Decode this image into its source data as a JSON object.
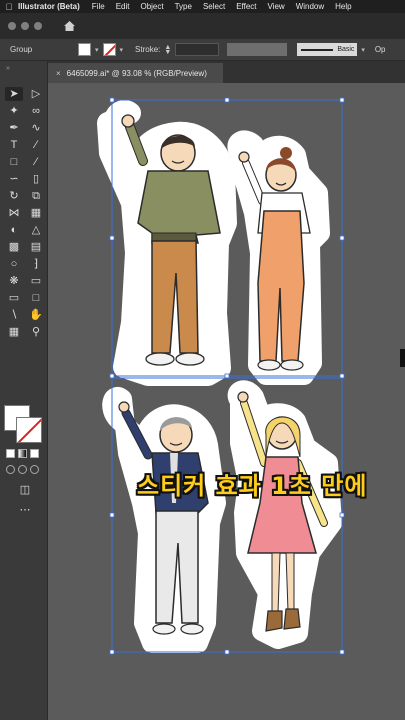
{
  "menubar": {
    "app_name": "Illustrator (Beta)",
    "items": [
      "File",
      "Edit",
      "Object",
      "Type",
      "Select",
      "Effect",
      "View",
      "Window",
      "Help"
    ]
  },
  "control_bar": {
    "selection_label": "Group",
    "stroke_label": "Stroke:",
    "brush_label": "Basic",
    "opacity_label": "Op"
  },
  "document": {
    "tab_title": "6465099.ai* @ 93.08 % (RGB/Preview)"
  },
  "overlay": {
    "caption": "스티커 효과 1초 만에"
  },
  "colors": {
    "canvas_bg": "#5b5b5b",
    "caption_fill": "#ffcc1a",
    "selection": "#3a6fd8"
  },
  "icons": [
    "apple-icon",
    "home-icon",
    "selection-tool-icon",
    "pen-tool-icon",
    "type-tool-icon",
    "zoom-tool-icon",
    "hand-tool-icon"
  ]
}
